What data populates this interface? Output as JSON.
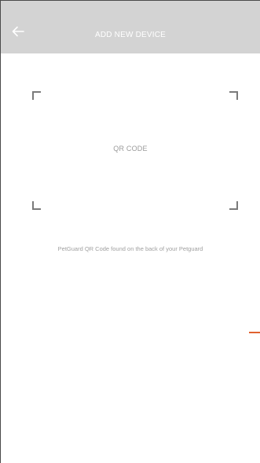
{
  "header": {
    "title": "ADD NEW DEVICE",
    "back_icon": "arrow-left-icon",
    "background_color": "#d3d3d3"
  },
  "scanner": {
    "placeholder_label": "QR CODE",
    "hint": "PetGuard QR Code found on the back of your Petguard"
  },
  "colors": {
    "accent": "#e0612f"
  }
}
